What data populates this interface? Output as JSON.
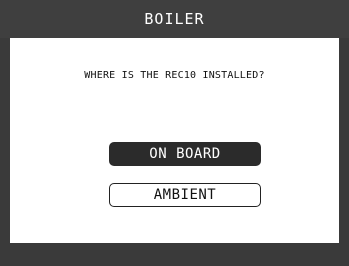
{
  "header": {
    "title": "BOILER"
  },
  "dialog": {
    "question": "WHERE IS THE REC10 INSTALLED?",
    "options": [
      {
        "label": "ON BOARD",
        "selected": true
      },
      {
        "label": "AMBIENT",
        "selected": false
      }
    ]
  },
  "colors": {
    "bar": "#3a3a3a",
    "panel": "#ffffff",
    "selected_bg": "#2b2b2b",
    "text": "#111111"
  }
}
